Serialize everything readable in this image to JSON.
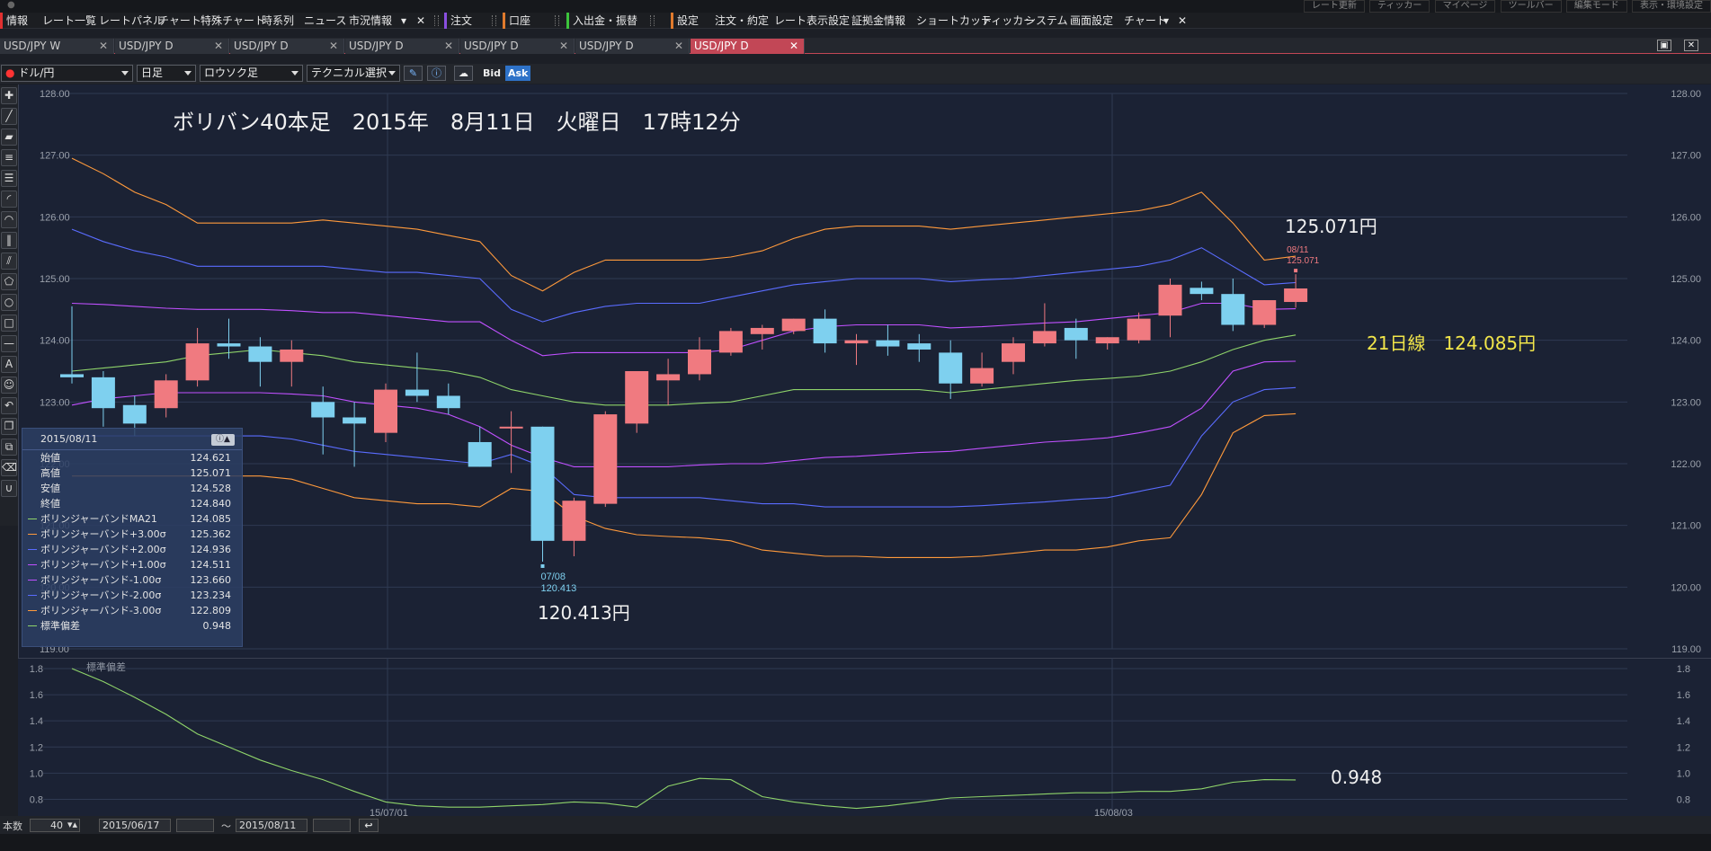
{
  "menu": {
    "items": [
      "情報",
      "レート一覧",
      "レートパネル",
      "チャート",
      "特殊チャート",
      "時系列",
      "ニュース",
      "市況情報",
      "注文",
      "口座",
      "入出金・振替",
      "設定",
      "注文・約定",
      "レート表示設定",
      "証拠金情報",
      "ショートカット",
      "ティッカー",
      "システム",
      "画面設定",
      "チャート"
    ],
    "right_items": [
      "レート更新",
      "ティッカー",
      "マイページ",
      "ツールバー",
      "編集モード",
      "表示・環境設定"
    ]
  },
  "tabs": [
    {
      "label": "USD/JPY W",
      "active": false
    },
    {
      "label": "USD/JPY D",
      "active": false
    },
    {
      "label": "USD/JPY D",
      "active": false
    },
    {
      "label": "USD/JPY D",
      "active": false
    },
    {
      "label": "USD/JPY D",
      "active": false
    },
    {
      "label": "USD/JPY D",
      "active": false
    },
    {
      "label": "USD/JPY D",
      "active": true
    }
  ],
  "controls": {
    "pair": "ドル/円",
    "timeframe": "日足",
    "chart_type": "ロウソク足",
    "technical": "テクニカル選択",
    "bid": "Bid",
    "ask": "Ask"
  },
  "status": {
    "count_label": "本数",
    "count_value": "40",
    "from_date": "2015/06/17",
    "tilde": "〜",
    "to_date": "2015/08/11"
  },
  "annotations": {
    "title": "ボリバン40本足　2015年　8月11日　火曜日　17時12分",
    "high_price": "125.071円",
    "low_price": "120.413円",
    "ma_label": "21日線　124.085円",
    "stddev_value": "0.948",
    "high_tag_date": "08/11",
    "high_tag_value": "125.071",
    "low_tag_date": "07/08",
    "low_tag_value": "120.413",
    "sub_title": "標準偏差"
  },
  "info_panel": {
    "date": "2015/08/11",
    "rows": [
      {
        "label": "始値",
        "value": "124.621",
        "color": ""
      },
      {
        "label": "高値",
        "value": "125.071",
        "color": ""
      },
      {
        "label": "安値",
        "value": "124.528",
        "color": ""
      },
      {
        "label": "終値",
        "value": "124.840",
        "color": ""
      },
      {
        "label": "ボリンジャーバンドMA21",
        "value": "124.085",
        "color": "#8fd46a"
      },
      {
        "label": "ボリンジャーバンド+3.00σ",
        "value": "125.362",
        "color": "#ff9a3c"
      },
      {
        "label": "ボリンジャーバンド+2.00σ",
        "value": "124.936",
        "color": "#5a6cff"
      },
      {
        "label": "ボリンジャーバンド+1.00σ",
        "value": "124.511",
        "color": "#c050ff"
      },
      {
        "label": "ボリンジャーバンド-1.00σ",
        "value": "123.660",
        "color": "#c050ff"
      },
      {
        "label": "ボリンジャーバンド-2.00σ",
        "value": "123.234",
        "color": "#5a6cff"
      },
      {
        "label": "ボリンジャーバンド-3.00σ",
        "value": "122.809",
        "color": "#ff9a3c"
      },
      {
        "label": "標準偏差",
        "value": "0.948",
        "color": "#8fd46a"
      }
    ]
  },
  "chart_data": {
    "type": "candlestick",
    "dates": [
      "15/07/01",
      "15/08/03"
    ],
    "yticks": [
      "128.00",
      "127.00",
      "126.00",
      "125.00",
      "124.00",
      "123.00",
      "122.00",
      "121.00",
      "120.00",
      "119.00"
    ],
    "ylim": [
      119,
      128
    ],
    "candles": [
      [
        123.45,
        124.55,
        123.3,
        123.4
      ],
      [
        123.4,
        123.5,
        122.6,
        122.9
      ],
      [
        122.95,
        123.1,
        122.45,
        122.65
      ],
      [
        122.9,
        123.45,
        122.75,
        123.35
      ],
      [
        123.35,
        124.2,
        123.25,
        123.95
      ],
      [
        123.95,
        124.35,
        123.7,
        123.9
      ],
      [
        123.9,
        124.05,
        123.25,
        123.65
      ],
      [
        123.65,
        124.0,
        123.25,
        123.85
      ],
      [
        123.0,
        123.25,
        122.15,
        122.75
      ],
      [
        122.75,
        123.0,
        121.95,
        122.65
      ],
      [
        122.5,
        123.3,
        122.35,
        123.2
      ],
      [
        123.2,
        123.8,
        123.0,
        123.1
      ],
      [
        123.1,
        123.3,
        122.8,
        122.9
      ],
      [
        122.35,
        122.6,
        121.95,
        121.95
      ],
      [
        122.6,
        122.85,
        121.85,
        122.6
      ],
      [
        122.6,
        122.6,
        120.413,
        120.75
      ],
      [
        120.75,
        121.45,
        120.5,
        121.4
      ],
      [
        121.35,
        122.85,
        121.3,
        122.8
      ],
      [
        122.65,
        123.5,
        122.5,
        123.5
      ],
      [
        123.35,
        123.7,
        122.95,
        123.45
      ],
      [
        123.45,
        124.05,
        123.35,
        123.85
      ],
      [
        123.8,
        124.2,
        123.75,
        124.15
      ],
      [
        124.1,
        124.25,
        123.85,
        124.2
      ],
      [
        124.15,
        124.35,
        124.1,
        124.35
      ],
      [
        124.35,
        124.5,
        123.8,
        123.95
      ],
      [
        123.95,
        124.1,
        123.6,
        124.0
      ],
      [
        124.0,
        124.25,
        123.75,
        123.9
      ],
      [
        123.95,
        124.1,
        123.65,
        123.85
      ],
      [
        123.8,
        124.0,
        123.05,
        123.3
      ],
      [
        123.3,
        123.8,
        123.25,
        123.55
      ],
      [
        123.65,
        124.05,
        123.45,
        123.95
      ],
      [
        123.95,
        124.6,
        123.9,
        124.15
      ],
      [
        124.2,
        124.35,
        123.7,
        124.0
      ],
      [
        123.95,
        124.05,
        123.85,
        124.05
      ],
      [
        124.0,
        124.45,
        123.95,
        124.35
      ],
      [
        124.4,
        125.0,
        124.05,
        124.9
      ],
      [
        124.85,
        124.95,
        124.65,
        124.75
      ],
      [
        124.75,
        125.0,
        124.15,
        124.25
      ],
      [
        124.25,
        124.65,
        124.2,
        124.65
      ],
      [
        124.621,
        125.071,
        124.528,
        124.84
      ]
    ],
    "bands": {
      "upper3": [
        126.95,
        126.7,
        126.4,
        126.2,
        125.9,
        125.9,
        125.9,
        125.9,
        125.95,
        125.9,
        125.85,
        125.8,
        125.7,
        125.6,
        125.05,
        124.8,
        125.1,
        125.3,
        125.3,
        125.3,
        125.3,
        125.35,
        125.45,
        125.65,
        125.8,
        125.85,
        125.85,
        125.85,
        125.8,
        125.85,
        125.9,
        125.95,
        126.0,
        126.05,
        126.1,
        126.2,
        126.4,
        125.9,
        125.3,
        125.362
      ],
      "upper2": [
        125.8,
        125.6,
        125.45,
        125.35,
        125.2,
        125.2,
        125.2,
        125.2,
        125.2,
        125.15,
        125.1,
        125.1,
        125.05,
        125.0,
        124.5,
        124.3,
        124.45,
        124.55,
        124.6,
        124.6,
        124.6,
        124.7,
        124.8,
        124.9,
        124.95,
        125.0,
        125.0,
        125.0,
        124.95,
        124.98,
        125.0,
        125.05,
        125.1,
        125.15,
        125.2,
        125.3,
        125.5,
        125.2,
        124.9,
        124.936
      ],
      "upper1": [
        124.6,
        124.58,
        124.55,
        124.52,
        124.5,
        124.5,
        124.5,
        124.48,
        124.45,
        124.45,
        124.4,
        124.35,
        124.3,
        124.3,
        124.0,
        123.75,
        123.8,
        123.8,
        123.8,
        123.8,
        123.8,
        123.85,
        124.0,
        124.15,
        124.22,
        124.25,
        124.25,
        124.25,
        124.2,
        124.22,
        124.25,
        124.28,
        124.3,
        124.35,
        124.4,
        124.45,
        124.6,
        124.6,
        124.5,
        124.511
      ],
      "ma": [
        123.5,
        123.55,
        123.6,
        123.65,
        123.75,
        123.8,
        123.85,
        123.8,
        123.75,
        123.65,
        123.6,
        123.55,
        123.5,
        123.4,
        123.2,
        123.1,
        123.0,
        122.95,
        122.95,
        122.95,
        122.98,
        123.0,
        123.1,
        123.2,
        123.2,
        123.2,
        123.2,
        123.2,
        123.15,
        123.2,
        123.25,
        123.3,
        123.35,
        123.38,
        123.42,
        123.5,
        123.65,
        123.85,
        124.0,
        124.085
      ],
      "lower1": [
        122.95,
        123.05,
        123.1,
        123.15,
        123.15,
        123.15,
        123.15,
        123.13,
        123.1,
        123.0,
        122.95,
        122.9,
        122.8,
        122.6,
        122.3,
        122.1,
        121.95,
        121.95,
        121.95,
        121.95,
        121.98,
        122.0,
        122.0,
        122.05,
        122.1,
        122.12,
        122.15,
        122.18,
        122.2,
        122.25,
        122.3,
        122.35,
        122.38,
        122.42,
        122.5,
        122.6,
        122.9,
        123.5,
        123.65,
        123.66
      ],
      "lower2": [
        122.45,
        122.45,
        122.45,
        122.45,
        122.45,
        122.45,
        122.45,
        122.4,
        122.3,
        122.2,
        122.15,
        122.1,
        122.05,
        122.0,
        122.15,
        121.95,
        121.5,
        121.45,
        121.45,
        121.45,
        121.45,
        121.4,
        121.35,
        121.35,
        121.3,
        121.3,
        121.3,
        121.3,
        121.3,
        121.32,
        121.35,
        121.38,
        121.42,
        121.45,
        121.55,
        121.65,
        122.45,
        123.0,
        123.2,
        123.234
      ],
      "lower3": [
        121.8,
        121.8,
        121.8,
        121.8,
        121.8,
        121.8,
        121.8,
        121.75,
        121.6,
        121.45,
        121.4,
        121.35,
        121.35,
        121.3,
        121.6,
        121.55,
        121.15,
        120.95,
        120.85,
        120.82,
        120.8,
        120.75,
        120.6,
        120.55,
        120.5,
        120.5,
        120.48,
        120.48,
        120.48,
        120.5,
        120.55,
        120.6,
        120.6,
        120.65,
        120.75,
        120.8,
        121.5,
        122.5,
        122.78,
        122.809
      ]
    },
    "stddev": {
      "yticks": [
        "1.8",
        "1.6",
        "1.4",
        "1.2",
        "1.0",
        "0.8"
      ],
      "ylim": [
        0.7,
        1.8
      ],
      "values": [
        1.8,
        1.7,
        1.58,
        1.45,
        1.3,
        1.2,
        1.1,
        1.02,
        0.95,
        0.86,
        0.78,
        0.75,
        0.74,
        0.74,
        0.75,
        0.76,
        0.78,
        0.77,
        0.74,
        0.9,
        0.96,
        0.95,
        0.82,
        0.78,
        0.75,
        0.73,
        0.75,
        0.78,
        0.81,
        0.82,
        0.83,
        0.84,
        0.85,
        0.85,
        0.86,
        0.86,
        0.88,
        0.93,
        0.95,
        0.948
      ]
    }
  },
  "colors": {
    "bg": "#1b2234",
    "up": "#f07a80",
    "down": "#7ed0ef",
    "ma": "#8fd46a",
    "sigma1": "#c050ff",
    "sigma2": "#5a6cff",
    "sigma3": "#ff9a3c",
    "accent_tab": "#c24756"
  }
}
